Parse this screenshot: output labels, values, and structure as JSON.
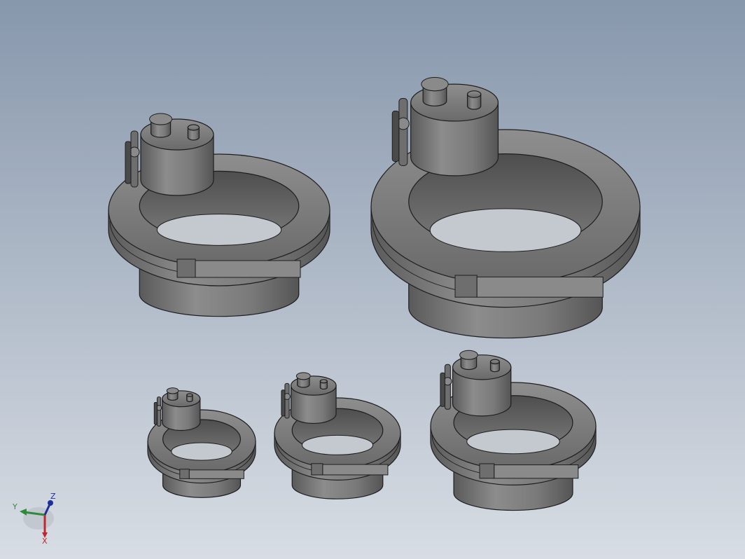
{
  "viewport": {
    "background_top": "#8797ac",
    "background_bottom": "#d8dde4"
  },
  "colors": {
    "body_light": "#8a8a8a",
    "body_mid": "#6e6e6e",
    "body_dark": "#4a4a4a",
    "edge": "#1e1e1e",
    "inner": "#5c5c5c"
  },
  "triad": {
    "x_label": "X",
    "y_label": "Y",
    "z_label": "Z",
    "x_color": "#c0272d",
    "y_color": "#2e8b3a",
    "z_color": "#1f2f9a"
  },
  "parts": [
    {
      "name": "upper-left-fitting"
    },
    {
      "name": "upper-right-fitting"
    },
    {
      "name": "lower-left-fitting"
    },
    {
      "name": "lower-middle-fitting"
    },
    {
      "name": "lower-right-fitting"
    }
  ]
}
